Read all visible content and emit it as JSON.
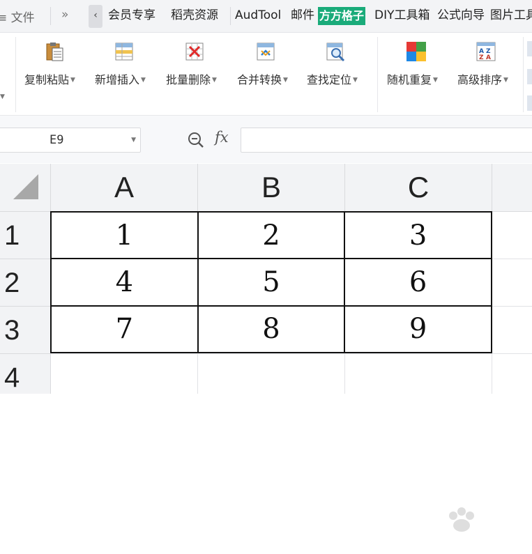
{
  "menubar": {
    "partial_left": "≡ 文件",
    "more": "»",
    "back": "‹",
    "items": [
      "会员专享",
      "稻壳资源",
      "AudTool",
      "邮件",
      "方方格子",
      "DIY工具箱",
      "公式向导",
      "图片工具"
    ],
    "active_tab": "方方格子",
    "active_color": "#1aab7a"
  },
  "ribbon": {
    "buttons": [
      {
        "label": "复制粘贴",
        "icon": "copy-paste-icon"
      },
      {
        "label": "新增插入",
        "icon": "insert-icon"
      },
      {
        "label": "批量删除",
        "icon": "batch-delete-icon"
      },
      {
        "label": "合并转换",
        "icon": "merge-convert-icon"
      },
      {
        "label": "查找定位",
        "icon": "find-locate-icon"
      },
      {
        "label": "随机重复",
        "icon": "random-repeat-icon"
      },
      {
        "label": "高级排序",
        "icon": "advanced-sort-icon"
      }
    ]
  },
  "formula_bar": {
    "cell_ref": "E9",
    "fx": "fx",
    "formula": ""
  },
  "grid": {
    "columns": [
      "A",
      "B",
      "C"
    ],
    "rows": [
      "1",
      "2",
      "3",
      "4"
    ],
    "cells": [
      [
        "1",
        "2",
        "3"
      ],
      [
        "4",
        "5",
        "6"
      ],
      [
        "7",
        "8",
        "9"
      ]
    ]
  },
  "colors": {
    "accent": "#1aab7a",
    "header_bg": "#f2f3f5",
    "border": "#111111"
  }
}
